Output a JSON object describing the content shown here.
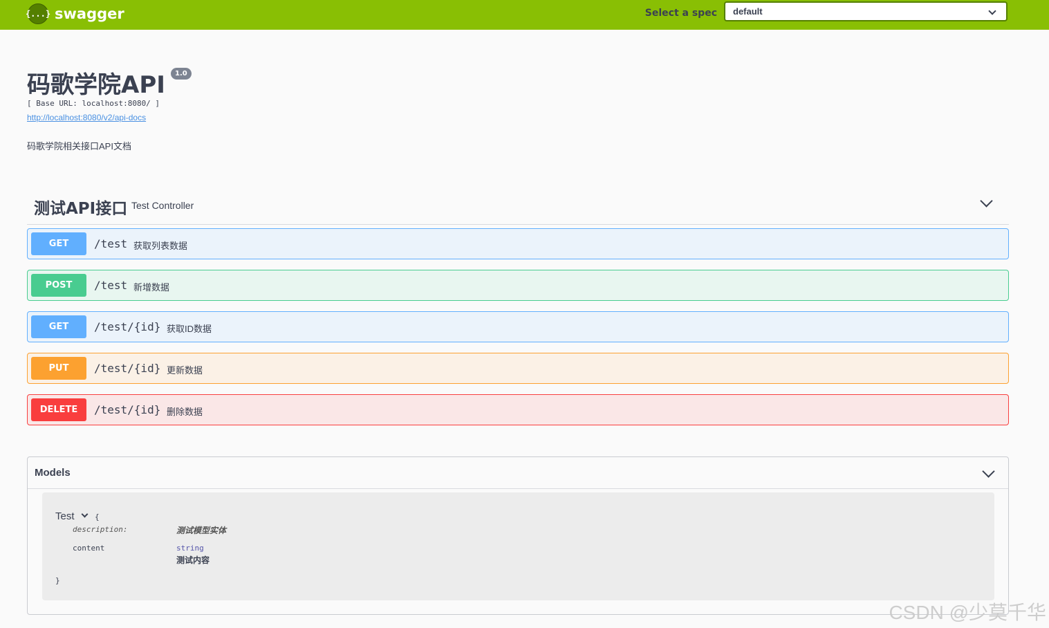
{
  "topbar": {
    "brand_icon": "{...}",
    "brand_name": "swagger",
    "spec_label": "Select a spec",
    "spec_value": "default",
    "accent_color": "#89bf04"
  },
  "info": {
    "title": "码歌学院API",
    "version": "1.0",
    "base_url": "[ Base URL: localhost:8080/ ]",
    "api_docs_link": "http://localhost:8080/v2/api-docs",
    "description": "码歌学院相关接口API文档"
  },
  "tag": {
    "name": "测试API接口",
    "description": "Test Controller"
  },
  "operations": [
    {
      "method": "GET",
      "path": "/test",
      "summary": "获取列表数据",
      "color": "#61affe"
    },
    {
      "method": "POST",
      "path": "/test",
      "summary": "新增数据",
      "color": "#49cc90"
    },
    {
      "method": "GET",
      "path": "/test/{id}",
      "summary": "获取ID数据",
      "color": "#61affe"
    },
    {
      "method": "PUT",
      "path": "/test/{id}",
      "summary": "更新数据",
      "color": "#fca130"
    },
    {
      "method": "DELETE",
      "path": "/test/{id}",
      "summary": "删除数据",
      "color": "#f93e3e"
    }
  ],
  "models": {
    "title": "Models",
    "model": {
      "name": "Test",
      "open_brace": "{",
      "close_brace": "}",
      "description_key": "description:",
      "description_value": "测试模型实体",
      "property_name": "content",
      "property_type": "string",
      "property_description": "测试内容"
    }
  },
  "watermark": "CSDN @少莫千华"
}
